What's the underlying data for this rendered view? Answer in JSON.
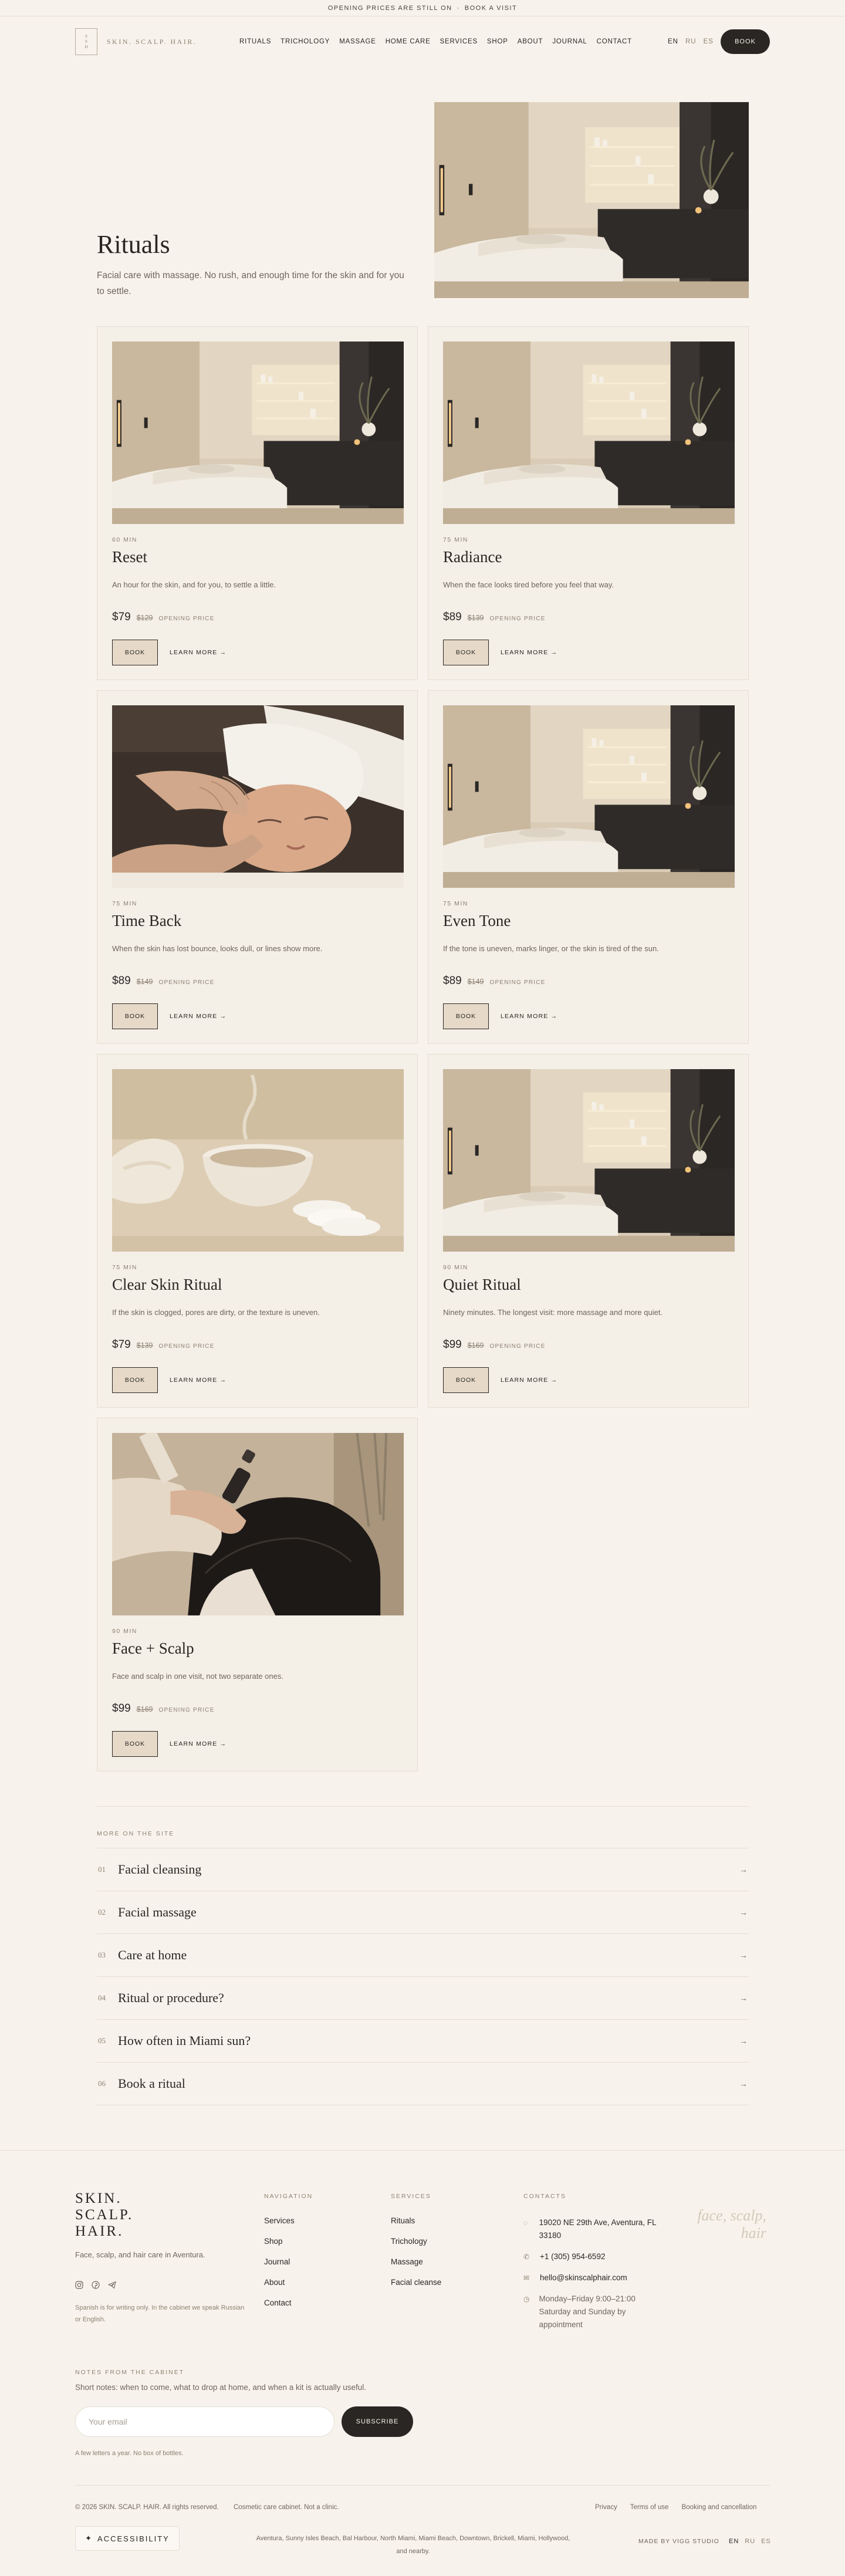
{
  "announcement": {
    "left": "OPENING PRICES ARE STILL ON",
    "sep": "·",
    "right": "BOOK A VISIT"
  },
  "header": {
    "logo_mark_lines": [
      "S",
      "S",
      "H"
    ],
    "logo_text": "SKIN. SCALP. HAIR.",
    "nav": [
      "RITUALS",
      "TRICHOLOGY",
      "MASSAGE",
      "HOME CARE",
      "SERVICES",
      "SHOP",
      "ABOUT",
      "JOURNAL",
      "CONTACT"
    ],
    "languages": [
      "EN",
      "RU",
      "ES"
    ],
    "book_label": "BOOK"
  },
  "hero": {
    "title": "Rituals",
    "subtitle": "Facial care with massage. No rush, and enough time for the skin and for you to settle."
  },
  "rituals": [
    {
      "duration": "60 MIN",
      "title": "Reset",
      "desc": "An hour for the skin, and for you, to settle a little.",
      "price": "$79",
      "old_price": "$129",
      "opening": "OPENING PRICE",
      "book": "BOOK",
      "learn": "LEARN MORE →",
      "image": "room"
    },
    {
      "duration": "75 MIN",
      "title": "Radiance",
      "desc": "When the face looks tired before you feel that way.",
      "price": "$89",
      "old_price": "$139",
      "opening": "OPENING PRICE",
      "book": "BOOK",
      "learn": "LEARN MORE →",
      "image": "room"
    },
    {
      "duration": "75 MIN",
      "title": "Time Back",
      "desc": "When the skin has lost bounce, looks dull, or lines show more.",
      "price": "$89",
      "old_price": "$149",
      "opening": "OPENING PRICE",
      "book": "BOOK",
      "learn": "LEARN MORE →",
      "image": "face-massage"
    },
    {
      "duration": "75 MIN",
      "title": "Even Tone",
      "desc": "If the tone is uneven, marks linger, or the skin is tired of the sun.",
      "price": "$89",
      "old_price": "$149",
      "opening": "OPENING PRICE",
      "book": "BOOK",
      "learn": "LEARN MORE →",
      "image": "room"
    },
    {
      "duration": "75 MIN",
      "title": "Clear Skin Ritual",
      "desc": "If the skin is clogged, pores are dirty, or the texture is uneven.",
      "price": "$79",
      "old_price": "$139",
      "opening": "OPENING PRICE",
      "book": "BOOK",
      "learn": "LEARN MORE →",
      "image": "bowl"
    },
    {
      "duration": "90 MIN",
      "title": "Quiet Ritual",
      "desc": "Ninety minutes. The longest visit: more massage and more quiet.",
      "price": "$99",
      "old_price": "$169",
      "opening": "OPENING PRICE",
      "book": "BOOK",
      "learn": "LEARN MORE →",
      "image": "room"
    },
    {
      "duration": "90 MIN",
      "title": "Face + Scalp",
      "desc": "Face and scalp in one visit, not two separate ones.",
      "price": "$99",
      "old_price": "$169",
      "opening": "OPENING PRICE",
      "book": "BOOK",
      "learn": "LEARN MORE →",
      "image": "scalp"
    }
  ],
  "more": {
    "label": "MORE ON THE SITE",
    "items": [
      {
        "num": "01",
        "text": "Facial cleansing"
      },
      {
        "num": "02",
        "text": "Facial massage"
      },
      {
        "num": "03",
        "text": "Care at home"
      },
      {
        "num": "04",
        "text": "Ritual or procedure?"
      },
      {
        "num": "05",
        "text": "How often in Miami sun?"
      },
      {
        "num": "06",
        "text": "Book a ritual"
      }
    ],
    "arrow": "→"
  },
  "footer": {
    "logo_lines": [
      "SKIN.",
      "SCALP.",
      "HAIR."
    ],
    "tagline": "Face, scalp, and hair care in Aventura.",
    "social_icons": [
      "instagram-icon",
      "pinterest-icon",
      "telegram-icon"
    ],
    "lang_note": "Spanish is for writing only. In the cabinet we speak Russian or English.",
    "navigation": {
      "heading": "NAVIGATION",
      "items": [
        "Services",
        "Shop",
        "Journal",
        "About",
        "Contact"
      ]
    },
    "services": {
      "heading": "SERVICES",
      "items": [
        "Rituals",
        "Trichology",
        "Massage",
        "Facial cleanse"
      ]
    },
    "contacts": {
      "heading": "CONTACTS",
      "address": "19020 NE 29th Ave, Aventura, FL 33180",
      "phone": "+1 (305) 954-6592",
      "email": "hello@skinscalphair.com",
      "hours": "Monday–Friday 9:00–21:00 Saturday and Sunday by appointment"
    },
    "script": "face, scalp, hair",
    "notes_heading": "NOTES FROM THE CABINET",
    "notes_sub": "Short notes: when to come, what to drop at home, and when a kit is actually useful.",
    "email_placeholder": "Your email",
    "subscribe": "SUBSCRIBE",
    "small": "A few letters a year. No box of bottles.",
    "copyright": "© 2026 SKIN. SCALP. HAIR. All rights reserved.",
    "cosmetic": "Cosmetic care cabinet. Not a clinic.",
    "links": [
      "Privacy",
      "Terms of use",
      "Booking and cancellation"
    ],
    "accessibility": "ACCESSIBILITY",
    "area": "Aventura, Sunny Isles Beach, Bal Harbour, North Miami, Miami Beach, Downtown, Brickell, Miami, Hollywood, and nearby.",
    "made_by": "MADE BY VIGG STUDIO",
    "languages": [
      "EN",
      "RU",
      "ES"
    ]
  },
  "colors": {
    "background": "#f7f3ec",
    "ink": "#2a2623",
    "muted": "#8d8173",
    "card": "#f4efe7",
    "button_fill": "#e6d9c8"
  }
}
